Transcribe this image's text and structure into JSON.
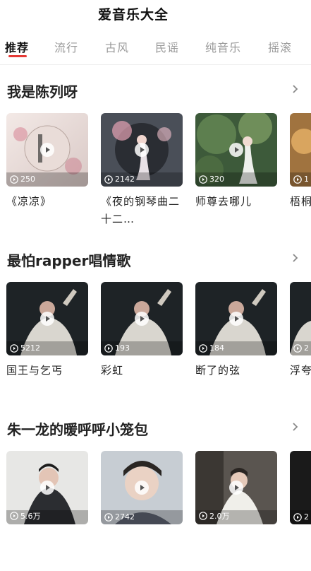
{
  "app": {
    "title": "爱音乐大全"
  },
  "tabs": [
    {
      "label": "推荐"
    },
    {
      "label": "流行"
    },
    {
      "label": "古风"
    },
    {
      "label": "民谣"
    },
    {
      "label": "纯音乐"
    },
    {
      "label": "摇滚"
    }
  ],
  "sections": [
    {
      "title": "我是陈列呀",
      "cards": [
        {
          "title": "《凉凉》",
          "count": "250"
        },
        {
          "title": "《夜的钢琴曲二十二…",
          "count": "2142"
        },
        {
          "title": "师尊去哪儿",
          "count": "320"
        },
        {
          "title": "梧桐你我",
          "count": "1"
        }
      ]
    },
    {
      "title": "最怕rapper唱情歌",
      "cards": [
        {
          "title": "国王与乞丐",
          "count": "5212"
        },
        {
          "title": "彩虹",
          "count": "193"
        },
        {
          "title": "断了的弦",
          "count": "184"
        },
        {
          "title": "浮夸",
          "count": "2"
        }
      ]
    },
    {
      "title": "朱一龙的暖呼呼小笼包",
      "cards": [
        {
          "title": "",
          "count": "5.6万"
        },
        {
          "title": "",
          "count": "2742"
        },
        {
          "title": "",
          "count": "2.0万"
        },
        {
          "title": "",
          "count": "2"
        }
      ]
    }
  ],
  "colors": {
    "accent": "#e53935",
    "tab_inactive": "#9a9a9a"
  },
  "icons": {
    "play": "play-icon",
    "more": "chevron-right-icon",
    "views": "play-count-icon"
  }
}
